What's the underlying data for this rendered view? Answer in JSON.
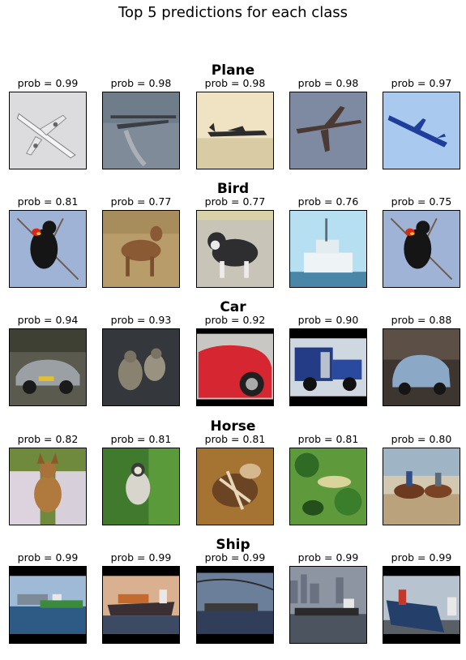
{
  "figure": {
    "title": "Top 5 predictions for each class"
  },
  "chart_data": {
    "type": "image_grid",
    "title": "Top 5 predictions for each class",
    "label_prefix": "prob = ",
    "rows": [
      {
        "class": "Plane",
        "probs": [
          "0.99",
          "0.98",
          "0.98",
          "0.98",
          "0.97"
        ],
        "labels": [
          "prob = 0.99",
          "prob = 0.98",
          "prob = 0.98",
          "prob = 0.98",
          "prob = 0.97"
        ],
        "images": [
          "airliner",
          "military-transport-plane",
          "patrol-plane",
          "jet-airliner",
          "blue-jet"
        ]
      },
      {
        "class": "Bird",
        "probs": [
          "0.81",
          "0.77",
          "0.77",
          "0.76",
          "0.75"
        ],
        "labels": [
          "prob = 0.81",
          "prob = 0.77",
          "prob = 0.77",
          "prob = 0.76",
          "prob = 0.75"
        ],
        "images": [
          "red-winged-blackbird",
          "deer",
          "husky-puppy",
          "ship",
          "red-winged-blackbird"
        ]
      },
      {
        "class": "Car",
        "probs": [
          "0.94",
          "0.93",
          "0.92",
          "0.90",
          "0.88"
        ],
        "labels": [
          "prob = 0.94",
          "prob = 0.93",
          "prob = 0.92",
          "prob = 0.90",
          "prob = 0.88"
        ],
        "images": [
          "silver-sports-car",
          "monkeys",
          "red-car",
          "blue-truck",
          "small-blue-car"
        ]
      },
      {
        "class": "Horse",
        "probs": [
          "0.82",
          "0.81",
          "0.81",
          "0.81",
          "0.80"
        ],
        "labels": [
          "prob = 0.82",
          "prob = 0.81",
          "prob = 0.81",
          "prob = 0.81",
          "prob = 0.80"
        ],
        "images": [
          "dog-held-by-person",
          "monkey-in-tree",
          "bird-in-hand",
          "green-foliage",
          "horse-riders"
        ]
      },
      {
        "class": "Ship",
        "probs": [
          "0.99",
          "0.99",
          "0.99",
          "0.99",
          "0.99"
        ],
        "labels": [
          "prob = 0.99",
          "prob = 0.99",
          "prob = 0.99",
          "prob = 0.99",
          "prob = 0.99"
        ],
        "images": [
          "green-ship-city",
          "cargo-ship",
          "ship-bridge",
          "ship-city-skyline",
          "cargo-ship-dock"
        ]
      }
    ]
  }
}
